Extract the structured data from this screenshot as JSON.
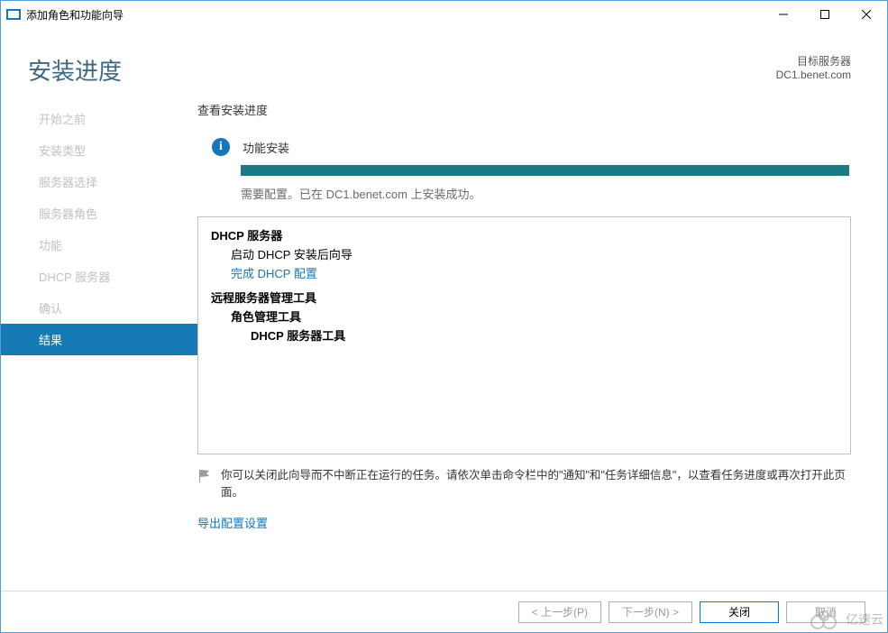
{
  "window": {
    "title": "添加角色和功能向导"
  },
  "header": {
    "page_title": "安装进度",
    "target_label": "目标服务器",
    "target_server": "DC1.benet.com"
  },
  "sidebar": {
    "items": [
      {
        "label": "开始之前"
      },
      {
        "label": "安装类型"
      },
      {
        "label": "服务器选择"
      },
      {
        "label": "服务器角色"
      },
      {
        "label": "功能"
      },
      {
        "label": "DHCP 服务器"
      },
      {
        "label": "确认"
      },
      {
        "label": "结果"
      }
    ]
  },
  "content": {
    "view_label": "查看安装进度",
    "info_text": "功能安装",
    "progress_msg": "需要配置。已在 DC1.benet.com 上安装成功。",
    "results": {
      "dhcp_server": "DHCP 服务器",
      "dhcp_start": "启动 DHCP 安装后向导",
      "dhcp_link": "完成 DHCP 配置",
      "rsat": "远程服务器管理工具",
      "role_tools": "角色管理工具",
      "dhcp_tools": "DHCP 服务器工具"
    },
    "tip_text": "你可以关闭此向导而不中断正在运行的任务。请依次单击命令栏中的\"通知\"和\"任务详细信息\"，以查看任务进度或再次打开此页面。",
    "export_link": "导出配置设置"
  },
  "footer": {
    "back": "< 上一步(P)",
    "next": "下一步(N) >",
    "close": "关闭",
    "cancel": "取消"
  },
  "watermark": {
    "text": "亿速云"
  }
}
